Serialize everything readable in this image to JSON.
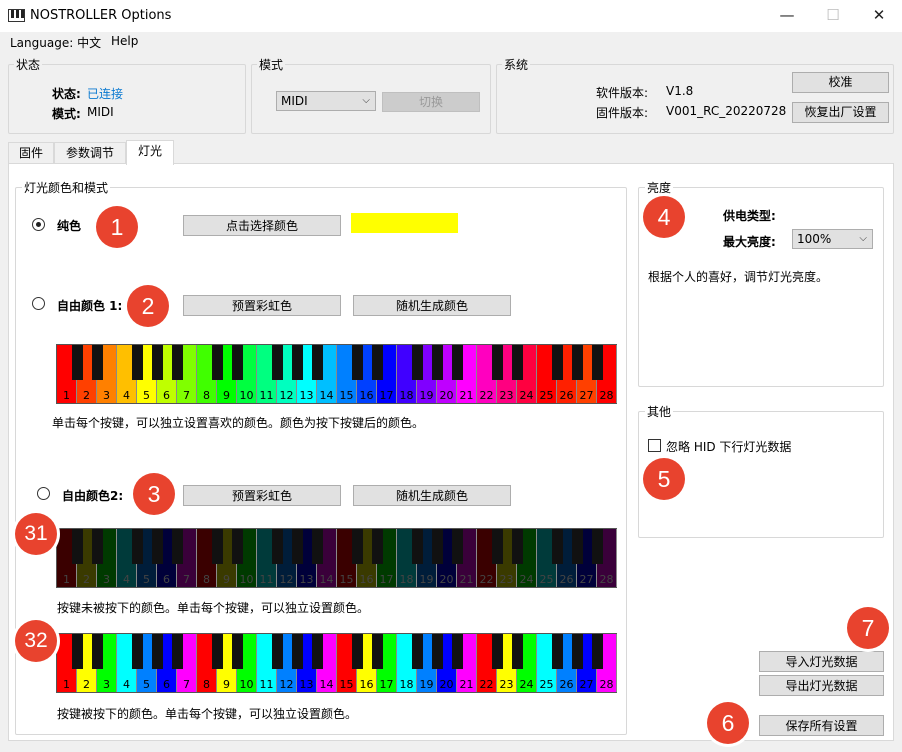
{
  "window": {
    "title": "NOSTROLLER  Options",
    "minimize": "—",
    "maximize": "☐",
    "close": "✕"
  },
  "menu": {
    "language": "Language: 中文",
    "help": "Help"
  },
  "status_group": {
    "title": "状态",
    "state_label": "状态:",
    "state_value": "已连接",
    "mode_label": "模式:",
    "mode_value": "MIDI",
    "state_color": "#0b79d0"
  },
  "mode_group": {
    "title": "模式",
    "selected": "MIDI",
    "switch_label": "切换"
  },
  "system_group": {
    "title": "系统",
    "sw_label": "软件版本:",
    "sw_value": "V1.8",
    "fw_label": "固件版本:",
    "fw_value": "V001_RC_20220728",
    "calibrate": "校准",
    "factory_reset": "恢复出厂设置"
  },
  "tabs": [
    "固件",
    "参数调节",
    "灯光"
  ],
  "light_group": {
    "title": "灯光颜色和模式",
    "solid": {
      "label": "纯色",
      "pick_button": "点击选择颜色",
      "swatch": "#ffff00"
    },
    "free1": {
      "label": "自由颜色 1:",
      "preset_button": "预置彩虹色",
      "random_button": "随机生成颜色",
      "hint": "单击每个按键，可以独立设置喜欢的颜色。颜色为按下按键后的颜色。"
    },
    "free2": {
      "label": "自由颜色2:",
      "preset_button": "预置彩虹色",
      "random_button": "随机生成颜色",
      "hint_unpressed": "按键未被按下的颜色。单击每个按键，可以独立设置颜色。",
      "hint_pressed": "按键被按下的颜色。单击每个按键，可以独立设置颜色。"
    }
  },
  "keyboards": {
    "rainbow1": [
      "#ff0000",
      "#ff4000",
      "#ff8000",
      "#ffbf00",
      "#ffff00",
      "#bfff00",
      "#80ff00",
      "#40ff00",
      "#00ff00",
      "#00ff40",
      "#00ff80",
      "#00ffbf",
      "#00ffff",
      "#00bfff",
      "#0080ff",
      "#0040ff",
      "#0000ff",
      "#4000ff",
      "#8000ff",
      "#bf00ff",
      "#ff00ff",
      "#ff00bf",
      "#ff0080",
      "#ff0040",
      "#ff0000",
      "#ff2000",
      "#ff4000",
      "#ff0000"
    ],
    "rainbow_pressed": [
      "#ff0000",
      "#ffff00",
      "#00ff00",
      "#00ffff",
      "#0080ff",
      "#0000ff",
      "#ff00ff",
      "#ff0000",
      "#ffff00",
      "#00ff00",
      "#00ffff",
      "#0080ff",
      "#0000ff",
      "#ff00ff",
      "#ff0000",
      "#ffff00",
      "#00ff00",
      "#00ffff",
      "#0080ff",
      "#0000ff",
      "#ff00ff",
      "#ff0000",
      "#ffff00",
      "#00ff00",
      "#00ffff",
      "#0080ff",
      "#0000ff",
      "#ff00ff"
    ],
    "rainbow_unpressed": [
      "#3a0000",
      "#3a3a00",
      "#003a00",
      "#003a3a",
      "#001d3a",
      "#00003a",
      "#3a003a",
      "#3a0000",
      "#3a3a00",
      "#003a00",
      "#003a3a",
      "#001d3a",
      "#00003a",
      "#3a003a",
      "#3a0000",
      "#3a3a00",
      "#003a00",
      "#003a3a",
      "#001d3a",
      "#00003a",
      "#3a003a",
      "#3a0000",
      "#3a3a00",
      "#003a00",
      "#003a3a",
      "#001d3a",
      "#00003a",
      "#3a003a"
    ]
  },
  "brightness_group": {
    "title": "亮度",
    "power_label": "供电类型:",
    "max_label": "最大亮度:",
    "max_value": "100%",
    "hint": "根据个人的喜好，调节灯光亮度。"
  },
  "other_group": {
    "title": "其他",
    "ignore_hid": "忽略 HID 下行灯光数据"
  },
  "actions": {
    "import": "导入灯光数据",
    "export": "导出灯光数据",
    "save_all": "保存所有设置"
  },
  "badges": [
    "1",
    "2",
    "3",
    "31",
    "32",
    "4",
    "5",
    "6",
    "7"
  ],
  "badge_color": "#e8432e"
}
